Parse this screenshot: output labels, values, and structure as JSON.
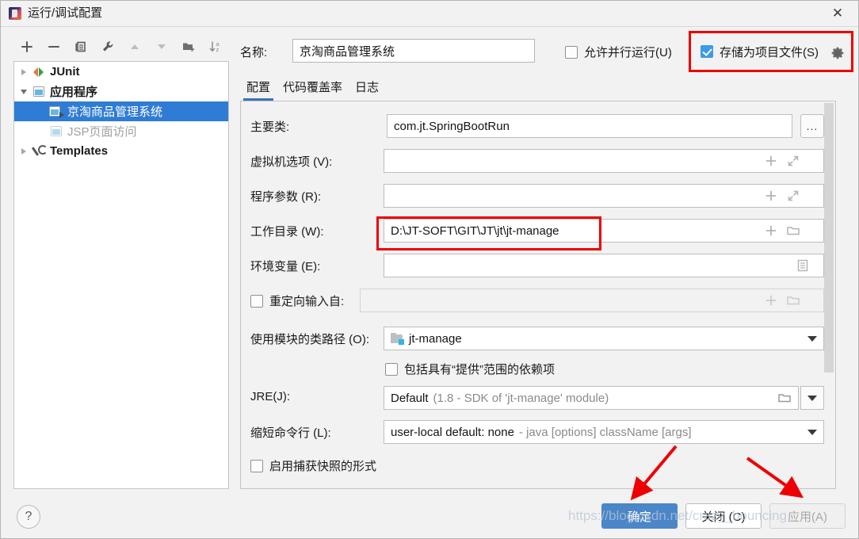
{
  "window": {
    "title": "运行/调试配置",
    "app_icon": "intellij-idea-icon",
    "close_label": "✕"
  },
  "toolbar": {
    "items": [
      {
        "icon": "add-icon",
        "name": "add-configuration-button"
      },
      {
        "icon": "remove-icon",
        "name": "remove-configuration-button"
      },
      {
        "icon": "copy-icon",
        "name": "copy-configuration-button"
      },
      {
        "icon": "wrench-icon",
        "name": "edit-templates-button"
      },
      {
        "icon": "arrow-up-icon",
        "name": "move-up-button"
      },
      {
        "icon": "arrow-down-icon",
        "name": "move-down-button"
      },
      {
        "icon": "new-folder-icon",
        "name": "create-folder-button"
      },
      {
        "icon": "sort-az-icon",
        "name": "sort-alphabetically-button"
      }
    ]
  },
  "tree": {
    "nodes": [
      {
        "label": "JUnit",
        "icon": "junit-icon",
        "expander": "collapsed",
        "indent": 1,
        "bold": true,
        "selected": false,
        "disabled": false
      },
      {
        "label": "应用程序",
        "icon": "application-icon",
        "expander": "expanded",
        "indent": 1,
        "bold": true,
        "selected": false,
        "disabled": false
      },
      {
        "label": "京淘商品管理系统",
        "icon": "run-config-icon",
        "expander": "none",
        "indent": 2,
        "bold": false,
        "selected": true,
        "disabled": false
      },
      {
        "label": "JSP页面访问",
        "icon": "application-icon",
        "expander": "none",
        "indent": 2,
        "bold": false,
        "selected": false,
        "disabled": true
      },
      {
        "label": "Templates",
        "icon": "wrench-icon",
        "expander": "collapsed",
        "indent": 1,
        "bold": true,
        "selected": false,
        "disabled": false
      }
    ]
  },
  "name_row": {
    "label": "名称:",
    "value": "京淘商品管理系统"
  },
  "options": {
    "allow_parallel": {
      "label": "允许并行运行(U)",
      "checked": false
    },
    "store_as_project_file": {
      "label": "存储为项目文件(S)",
      "checked": true,
      "gear_icon": "gear-icon"
    }
  },
  "tabs": [
    {
      "label": "配置",
      "active": true
    },
    {
      "label": "代码覆盖率",
      "active": false
    },
    {
      "label": "日志",
      "active": false
    }
  ],
  "form": {
    "main_class": {
      "label": "主要类:",
      "value": "com.jt.SpringBootRun",
      "browse_label": "..."
    },
    "vm_options": {
      "label": "虚拟机选项 (V):",
      "value": ""
    },
    "program_args": {
      "label": "程序参数 (R):",
      "value": ""
    },
    "working_dir": {
      "label": "工作目录 (W):",
      "value": "D:\\JT-SOFT\\GIT\\JT\\jt\\jt-manage"
    },
    "env_vars": {
      "label": "环境变量 (E):",
      "value": ""
    },
    "redirect_input": {
      "label": "重定向输入自:",
      "value": "",
      "checked": false
    },
    "module_classpath": {
      "label": "使用模块的类路径 (O):",
      "value": "jt-manage"
    },
    "include_provided": {
      "label": "包括具有“提供”范围的依赖项",
      "checked": false
    },
    "jre": {
      "label": "JRE(J):",
      "value_strong": "Default",
      "value_muted": "(1.8 - SDK of 'jt-manage' module)"
    },
    "shorten_cmdline": {
      "label": "缩短命令行 (L):",
      "value_strong": "user-local default: none",
      "value_muted": "- java [options] className [args]"
    },
    "enable_snapshot": {
      "label": "启用捕获快照的形式",
      "checked": false
    }
  },
  "footer": {
    "help_label": "?",
    "ok_label": "确定",
    "close_label": "关闭 (C)",
    "apply_label": "应用(A)"
  },
  "annotations": {
    "watermark": "https://blog.csdn.net/crazy_bouncing",
    "highlight_color": "#ee0000",
    "arrow_color": "#ee0000"
  }
}
